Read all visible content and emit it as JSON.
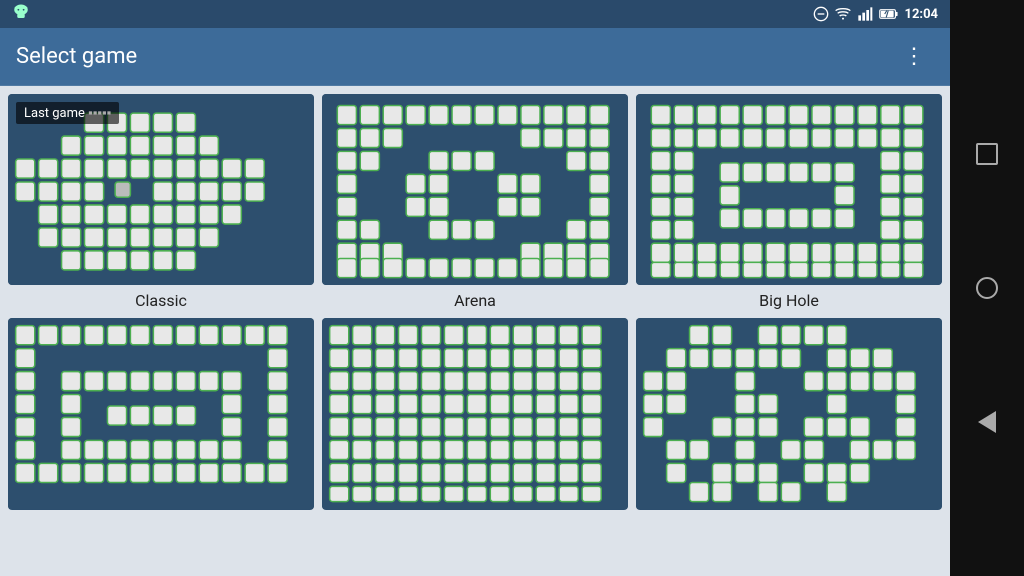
{
  "statusBar": {
    "time": "12:04",
    "icons": [
      "minus-circle",
      "wifi",
      "signal",
      "battery"
    ]
  },
  "toolbar": {
    "title": "Select game",
    "moreLabel": "⋮"
  },
  "games": [
    {
      "id": "classic",
      "label": "Classic",
      "isLastGame": true,
      "lastGameLabel": "Last game",
      "thumbnail": "classic"
    },
    {
      "id": "arena",
      "label": "Arena",
      "isLastGame": false,
      "thumbnail": "arena"
    },
    {
      "id": "bighole",
      "label": "Big Hole",
      "isLastGame": false,
      "thumbnail": "bighole"
    },
    {
      "id": "spiral",
      "label": "",
      "isLastGame": false,
      "thumbnail": "spiral"
    },
    {
      "id": "full",
      "label": "",
      "isLastGame": false,
      "thumbnail": "full"
    },
    {
      "id": "scattered",
      "label": "",
      "isLastGame": false,
      "thumbnail": "scattered"
    }
  ],
  "nav": {
    "square": "□",
    "circle": "○",
    "back": "◁"
  }
}
